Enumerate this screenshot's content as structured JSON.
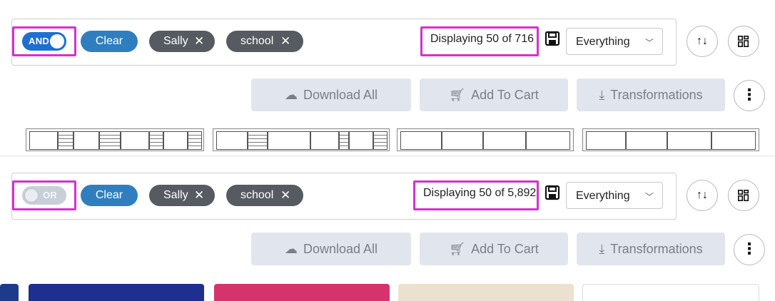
{
  "views": [
    {
      "toggle": {
        "label": "AND",
        "state": "on"
      },
      "clear_label": "Clear",
      "chips": [
        {
          "label": "Sally",
          "remove_glyph": "✕"
        },
        {
          "label": "school",
          "remove_glyph": "✕"
        }
      ],
      "count_text": "Displaying 50 of 716",
      "select_value": "Everything",
      "actions": {
        "download_all": "Download All",
        "add_to_cart": "Add To Cart",
        "transformations": "Transformations"
      }
    },
    {
      "toggle": {
        "label": "OR",
        "state": "off"
      },
      "clear_label": "Clear",
      "chips": [
        {
          "label": "Sally",
          "remove_glyph": "✕"
        },
        {
          "label": "school",
          "remove_glyph": "✕"
        }
      ],
      "count_text": "Displaying 50 of 5,892",
      "select_value": "Everything",
      "actions": {
        "download_all": "Download All",
        "add_to_cart": "Add To Cart",
        "transformations": "Transformations"
      }
    }
  ],
  "icons": {
    "save": "save-icon",
    "sort": "sort-icon",
    "grid": "grid-view-icon",
    "download": "cloud-download-icon",
    "cart": "cart-icon",
    "transform": "download-tray-icon",
    "more": "more-vertical-icon",
    "chevron": "chevron-down-icon"
  },
  "colors": {
    "highlight": "#d62fd3",
    "toggle_on": "#1f6fd1",
    "clear_button": "#2f7fc0",
    "chip": "#555b60",
    "action_bg": "#e1e6ee",
    "card_colors": [
      "#1e3a8a",
      "#1e2f8f",
      "#d6336c",
      "#ece0d0",
      "#ffffff"
    ]
  }
}
